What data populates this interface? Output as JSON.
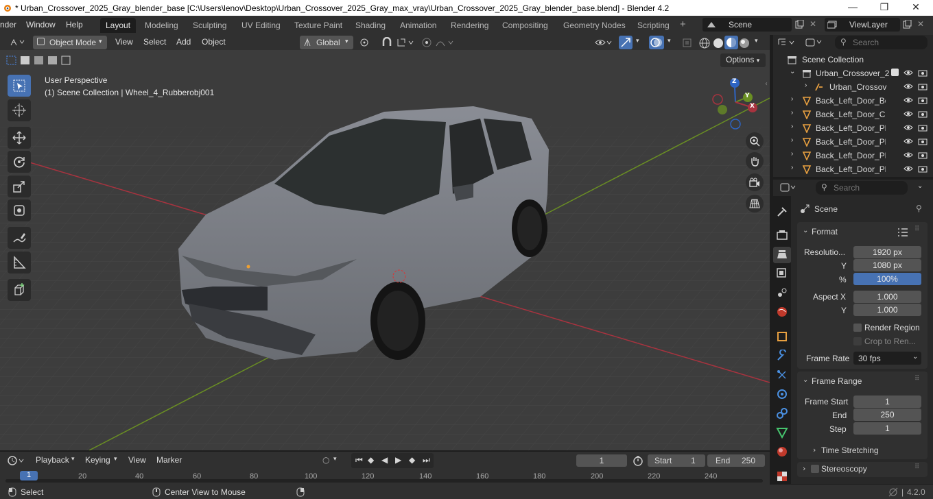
{
  "window": {
    "title": "* Urban_Crossover_2025_Gray_blender_base [C:\\Users\\lenov\\Desktop\\Urban_Crossover_2025_Gray_max_vray\\Urban_Crossover_2025_Gray_blender_base.blend] - Blender 4.2",
    "minimize": "—",
    "maximize": "❐",
    "close": "✕"
  },
  "menus": [
    "nder",
    "Window",
    "Help"
  ],
  "workspaces": [
    "Layout",
    "Modeling",
    "Sculpting",
    "UV Editing",
    "Texture Paint",
    "Shading",
    "Animation",
    "Rendering",
    "Compositing",
    "Geometry Nodes",
    "Scripting"
  ],
  "add_workspace": "+",
  "scene": {
    "name": "Scene"
  },
  "viewlayer": {
    "name": "ViewLayer"
  },
  "viewport_header": {
    "mode": "Object Mode",
    "menus": [
      "View",
      "Select",
      "Add",
      "Object"
    ],
    "transform": "Global",
    "options": "Options"
  },
  "viewport": {
    "perspective": "User Perspective",
    "context": "(1) Scene Collection | Wheel_4_Rubberobj001",
    "gizmo": {
      "x": "X",
      "y": "Y",
      "z": "Z"
    }
  },
  "outliner": {
    "search_placeholder": "Search",
    "root": "Scene Collection",
    "rows": [
      "Urban_Crossover_2",
      "Urban_Crossov",
      "Back_Left_Door_Bo",
      "Back_Left_Door_Clo",
      "Back_Left_Door_Pla",
      "Back_Left_Door_Pla",
      "Back_Left_Door_Pla",
      "Back_Left_Door_Pla"
    ]
  },
  "properties": {
    "search_placeholder": "Search",
    "context": "Scene",
    "format": {
      "header": "Format",
      "res_label": "Resolutio...",
      "res_x": "1920 px",
      "y_label": "Y",
      "res_y": "1080 px",
      "pct_label": "%",
      "pct": "100%",
      "aspect_label": "Aspect X",
      "aspect_x": "1.000",
      "aspect_y_label": "Y",
      "aspect_y": "1.000",
      "render_region": "Render Region",
      "crop": "Crop to Ren...",
      "fr_label": "Frame Rate",
      "fr": "30 fps"
    },
    "frame_range": {
      "header": "Frame Range",
      "start_label": "Frame Start",
      "start": "1",
      "end_label": "End",
      "end": "250",
      "step_label": "Step",
      "step": "1"
    },
    "time_stretching": "Time Stretching",
    "stereoscopy": "Stereoscopy"
  },
  "timeline": {
    "menus": [
      "Playback",
      "Keying",
      "View",
      "Marker"
    ],
    "current": "1",
    "start_label": "Start",
    "start": "1",
    "end_label": "End",
    "end": "250",
    "current_marker": "1",
    "ticks": [
      "20",
      "40",
      "60",
      "80",
      "100",
      "120",
      "140",
      "160",
      "180",
      "200",
      "220",
      "240"
    ]
  },
  "status": {
    "select": "Select",
    "center": "Center View to Mouse",
    "version": "4.2.0"
  },
  "colors": {
    "accent": "#4772b3",
    "x_axis": "#a8333f",
    "y_axis": "#6a8f23",
    "z_axis": "#2e64c2"
  }
}
